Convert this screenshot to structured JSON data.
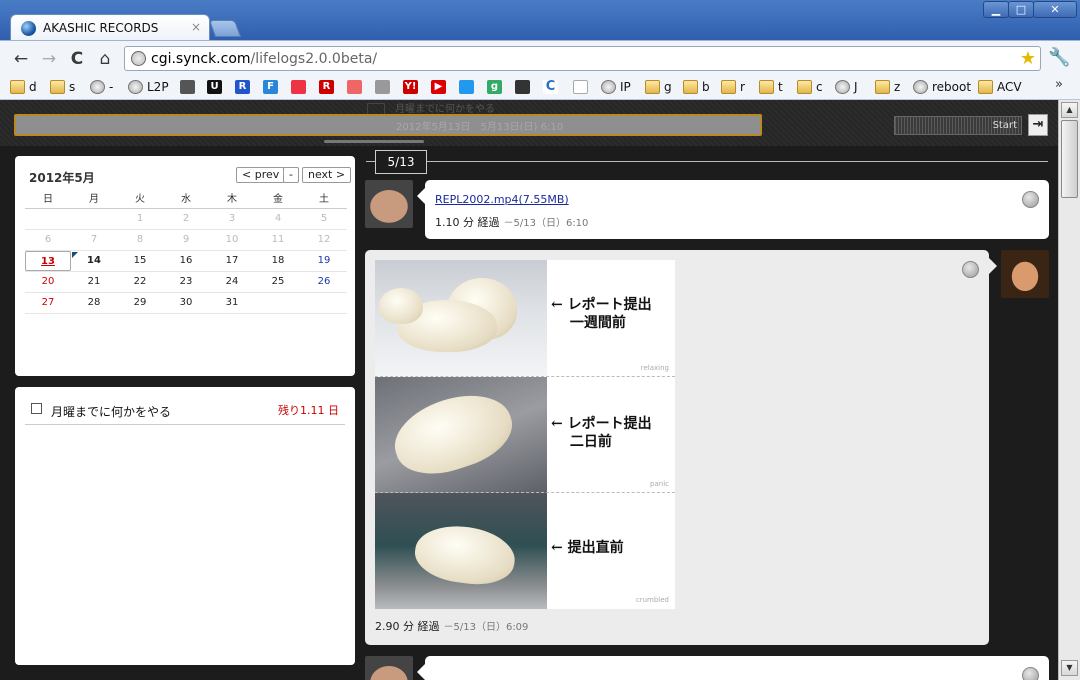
{
  "window": {
    "tab_title": "AKASHIC RECORDS",
    "close_glyph": "×",
    "controls": {
      "minimize": "▁",
      "maximize": "□",
      "close": "✕"
    }
  },
  "toolbar": {
    "url_host": "cgi.synck.com",
    "url_path": "/lifelogs2.0.0beta/",
    "back": "←",
    "forward": "→",
    "reload": "C",
    "home": "⌂",
    "star": "★",
    "wrench": "🔧"
  },
  "bookmarks": [
    {
      "label": "d",
      "icon": "folder-icon"
    },
    {
      "label": "s",
      "icon": "folder-icon"
    },
    {
      "label": "-",
      "icon": "globe-icon"
    },
    {
      "label": "L2P",
      "icon": "globe-icon"
    },
    {
      "label": "",
      "icon": "avatar-icon"
    },
    {
      "label": "",
      "icon": "u-icon",
      "glyph": "U"
    },
    {
      "label": "",
      "icon": "r-icon",
      "glyph": "R"
    },
    {
      "label": "",
      "icon": "f-icon",
      "glyph": "F"
    },
    {
      "label": "",
      "icon": "cube-icon"
    },
    {
      "label": "",
      "icon": "rakuten-icon",
      "glyph": "R"
    },
    {
      "label": "",
      "icon": "reader-icon"
    },
    {
      "label": "",
      "icon": "apple-icon"
    },
    {
      "label": "",
      "icon": "yahoo-icon",
      "glyph": "Y!"
    },
    {
      "label": "",
      "icon": "youtube-icon",
      "glyph": "▶"
    },
    {
      "label": "",
      "icon": "shuffle-icon"
    },
    {
      "label": "",
      "icon": "g-icon",
      "glyph": "g"
    },
    {
      "label": "",
      "icon": "book-icon"
    },
    {
      "label": "",
      "icon": "refresh-icon",
      "glyph": "C"
    },
    {
      "label": "",
      "icon": "page-icon"
    },
    {
      "label": "IP",
      "icon": "globe-icon"
    },
    {
      "label": "g",
      "icon": "folder-icon"
    },
    {
      "label": "b",
      "icon": "folder-icon"
    },
    {
      "label": "r",
      "icon": "folder-icon"
    },
    {
      "label": "t",
      "icon": "folder-icon"
    },
    {
      "label": "c",
      "icon": "folder-icon"
    },
    {
      "label": "J",
      "icon": "globe-icon"
    },
    {
      "label": "z",
      "icon": "folder-icon"
    },
    {
      "label": "reboot",
      "icon": "globe-icon"
    },
    {
      "label": "ACV",
      "icon": "folder-icon"
    }
  ],
  "bookmarks_more": "»",
  "topbar": {
    "ghost_text": "月曜までに何かをやる",
    "ghost_date": "2012年5月13日　5月13日(日) 6:10",
    "start_label": "Start",
    "exit_glyph": "⇥"
  },
  "calendar": {
    "title": "2012年5月",
    "prev": "< prev",
    "current": "-",
    "next": "next >",
    "weekdays": [
      "日",
      "月",
      "火",
      "水",
      "木",
      "金",
      "土"
    ],
    "weeks": [
      [
        "",
        "",
        "1",
        "2",
        "3",
        "4",
        "5"
      ],
      [
        "6",
        "7",
        "8",
        "9",
        "10",
        "11",
        "12"
      ],
      [
        "13",
        "14",
        "15",
        "16",
        "17",
        "18",
        "19"
      ],
      [
        "20",
        "21",
        "22",
        "23",
        "24",
        "25",
        "26"
      ],
      [
        "27",
        "28",
        "29",
        "30",
        "31",
        "",
        ""
      ]
    ]
  },
  "todo": {
    "label": "月曜までに何かをやる",
    "remaining": "残り1.11 日"
  },
  "timeline": {
    "date_tag": "5/13",
    "posts": [
      {
        "link": "REPL2002.mp4(7.55MB)",
        "elapsed": "1.10 分 経過",
        "stamp": "－5/13（日）6:10"
      },
      {
        "elapsed": "2.90 分 経過",
        "stamp": "－5/13（日）6:09",
        "captions": [
          "← レポート提出\n　 一週間前",
          "← レポート提出\n　 二日前",
          "← 提出直前"
        ],
        "panel_tags": [
          "relaxing",
          "panic",
          "crumbled"
        ]
      }
    ]
  },
  "scrollbar": {
    "up": "▲",
    "down": "▼"
  }
}
